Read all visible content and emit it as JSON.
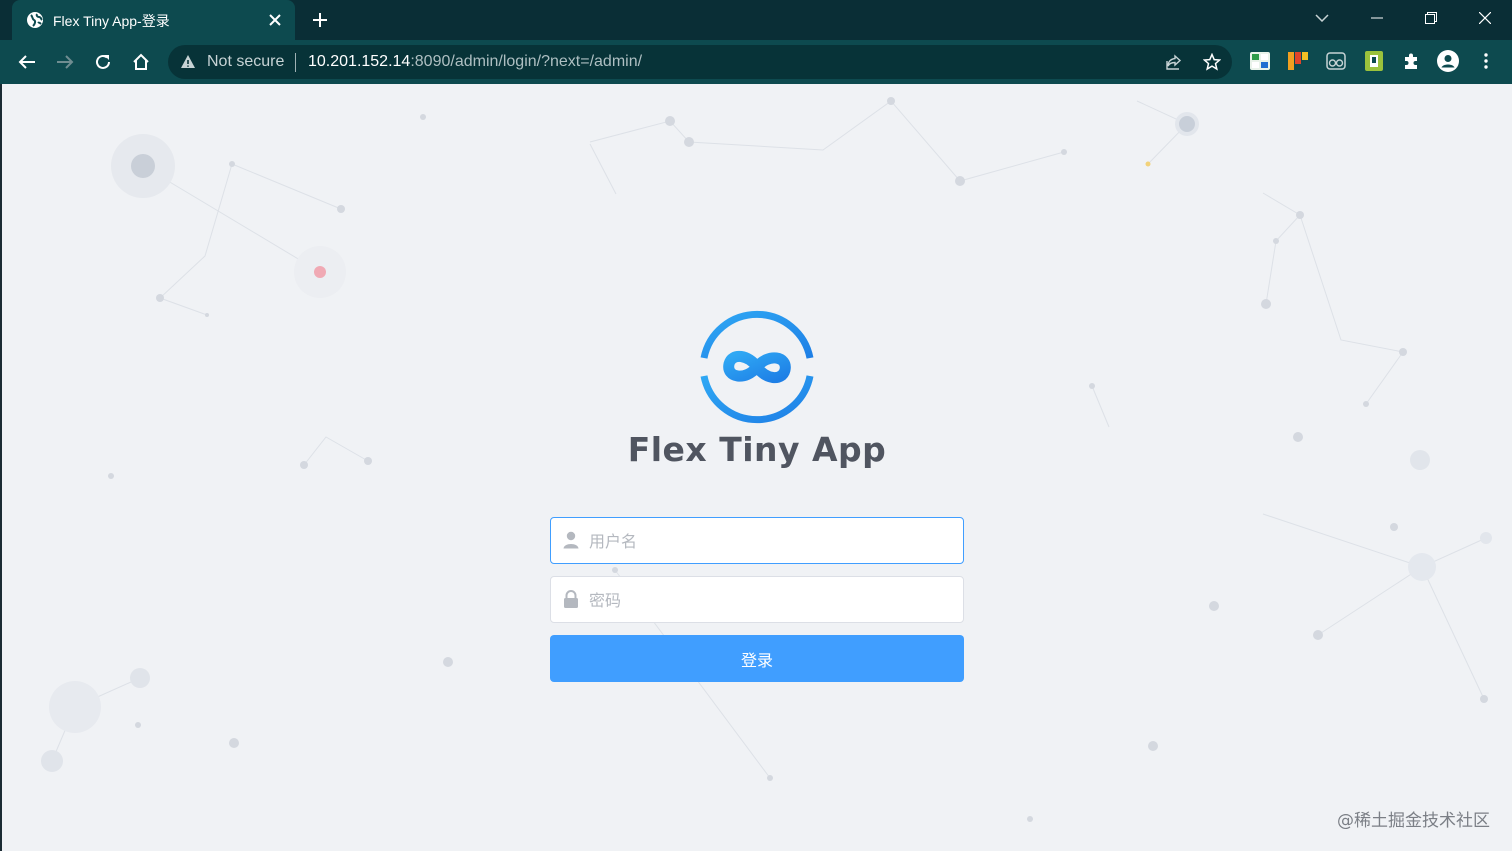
{
  "browser": {
    "tab_title": "Flex Tiny App-登录",
    "security_label": "Not secure",
    "url_host": "10.201.152.14",
    "url_rest": ":8090/admin/login/?next=/admin/"
  },
  "login": {
    "app_name": "Flex Tiny App",
    "username_placeholder": "用户名",
    "password_placeholder": "密码",
    "submit_label": "登录",
    "accent_color": "#409eff"
  },
  "watermark": "@稀土掘金技术社区"
}
